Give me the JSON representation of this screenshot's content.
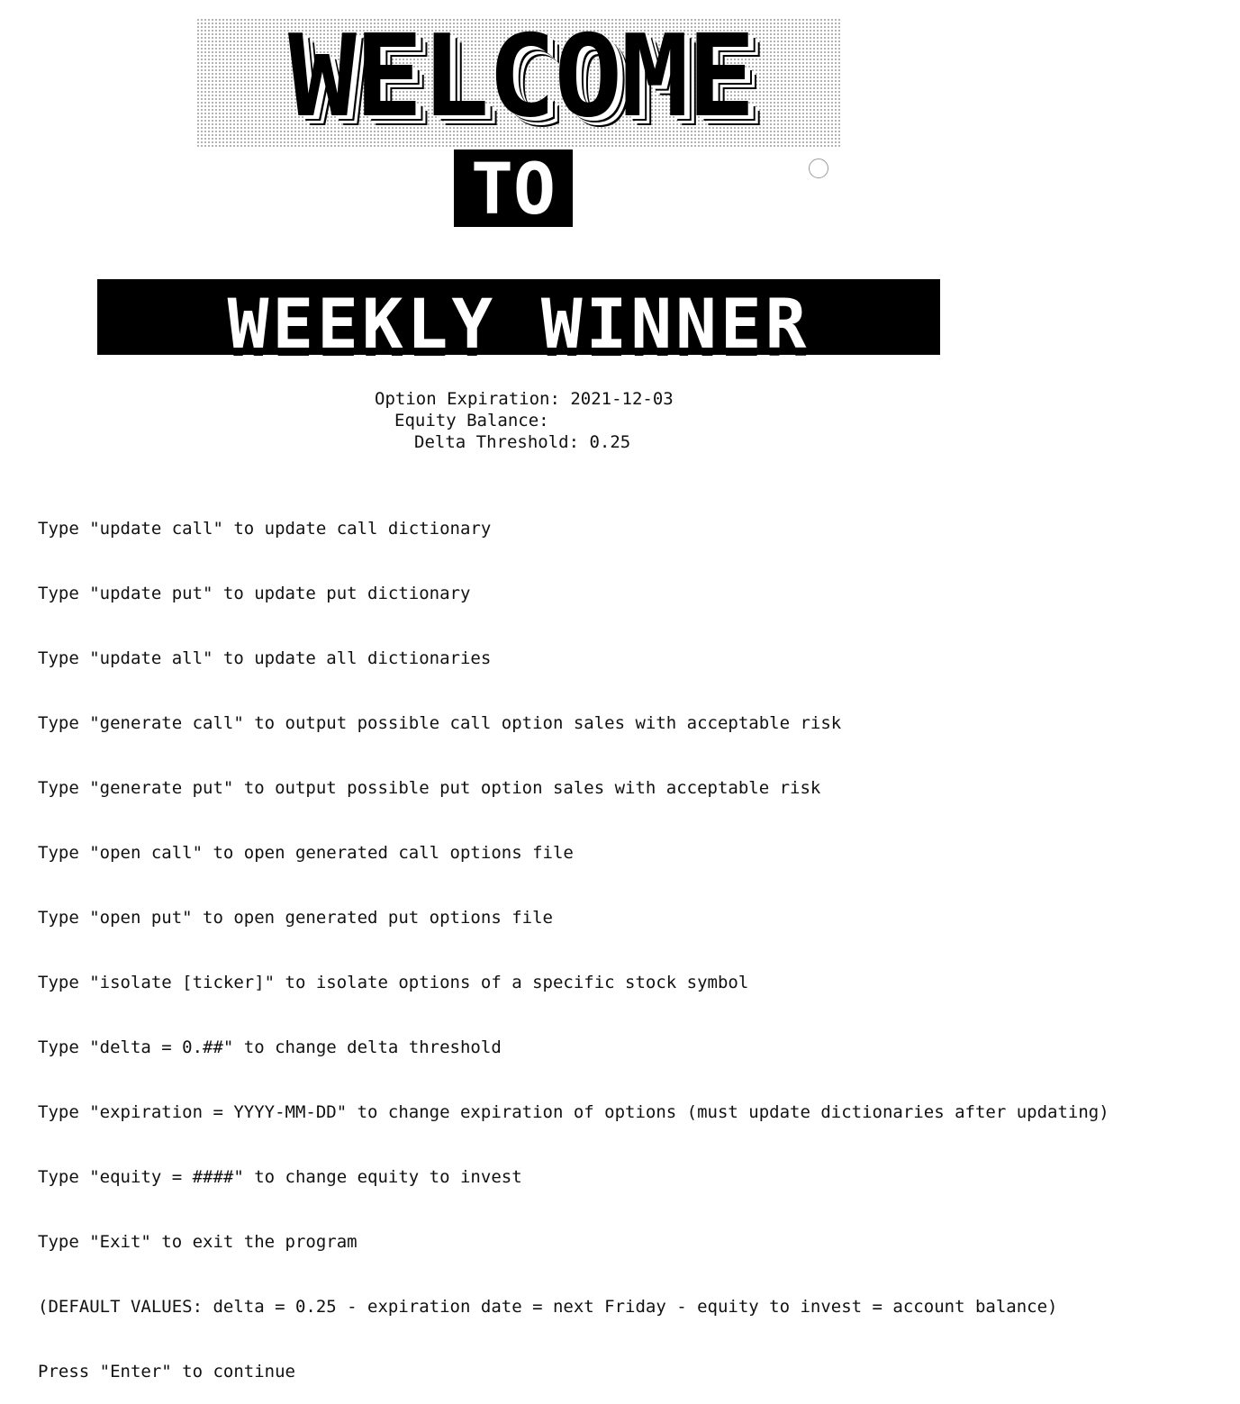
{
  "banner": {
    "welcome": "WELCOME",
    "to": "TO",
    "title": "WEEKLY WINNER"
  },
  "status": {
    "option_expiration_label": "Option Expiration:",
    "option_expiration_value": "2021-12-03",
    "equity_balance_label": "Equity Balance:",
    "equity_balance_value": "",
    "delta_threshold_label": "Delta Threshold:",
    "delta_threshold_value": "0.25"
  },
  "commands": [
    "Type \"update call\" to update call dictionary",
    "Type \"update put\" to update put dictionary",
    "Type \"update all\" to update all dictionaries",
    "Type \"generate call\" to output possible call option sales with acceptable risk",
    "Type \"generate put\" to output possible put option sales with acceptable risk",
    "Type \"open call\" to open generated call options file",
    "Type \"open put\" to open generated put options file",
    "Type \"isolate [ticker]\" to isolate options of a specific stock symbol",
    "Type \"delta = 0.##\" to change delta threshold",
    "Type \"expiration = YYYY-MM-DD\" to change expiration of options (must update dictionaries after updating)",
    "Type \"equity = ####\" to change equity to invest",
    "Type \"Exit\" to exit the program",
    "(DEFAULT VALUES: delta = 0.25 - expiration date = next Friday - equity to invest = account balance)",
    "Press \"Enter\" to continue"
  ],
  "icons": {
    "cursor": "circle-cursor-icon"
  }
}
